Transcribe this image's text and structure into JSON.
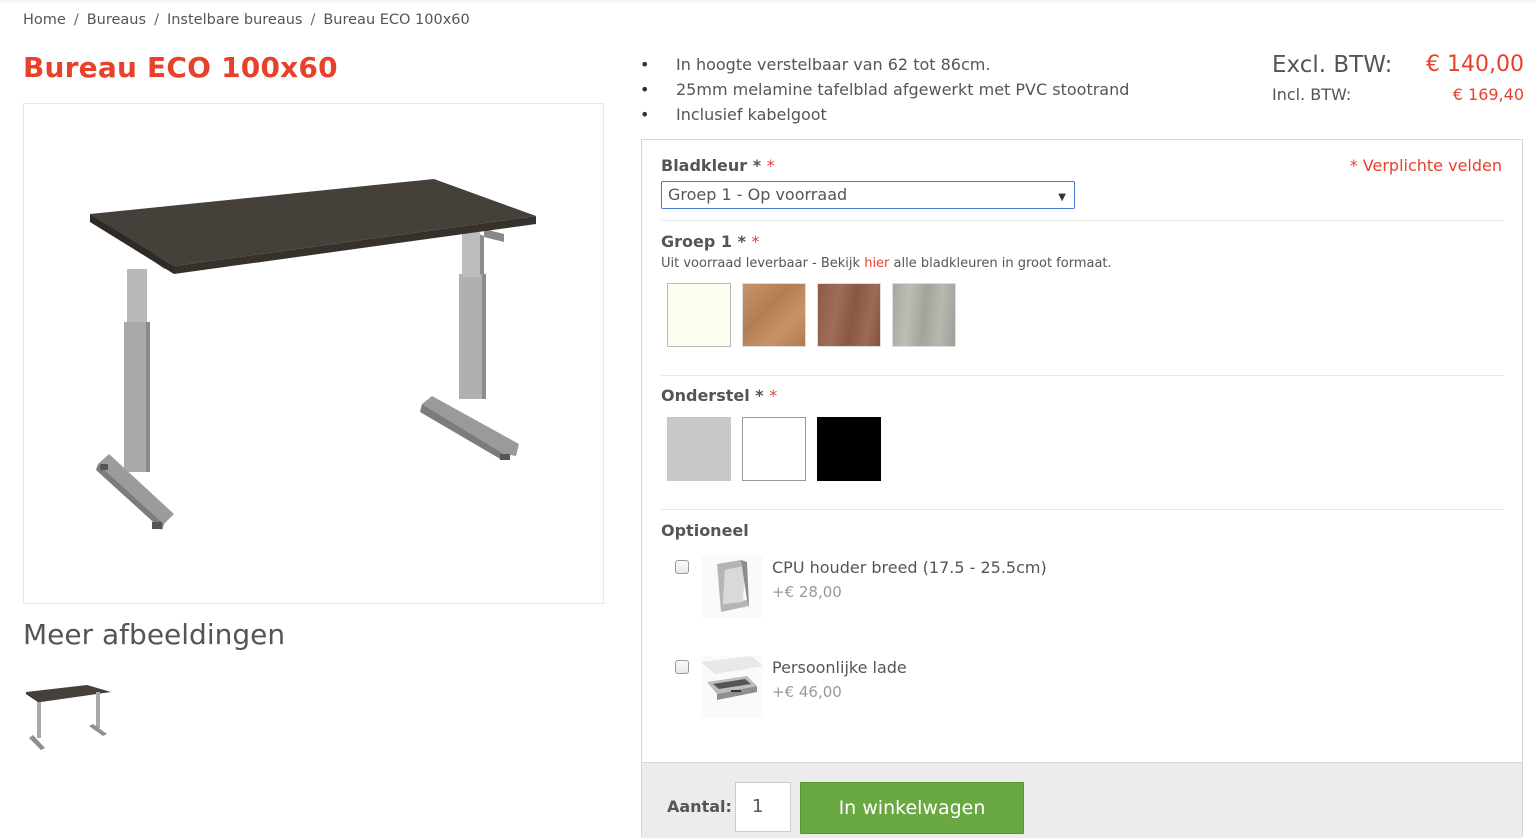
{
  "breadcrumb": {
    "items": [
      "Home",
      "Bureaus",
      "Instelbare bureaus",
      "Bureau ECO 100x60"
    ],
    "separator": "/"
  },
  "product": {
    "title": "Bureau ECO 100x60",
    "more_images_title": "Meer afbeeldingen",
    "features": [
      "In hoogte verstelbaar van 62 tot 86cm.",
      "25mm melamine tafelblad afgewerkt met PVC stootrand",
      "Inclusief kabelgoot"
    ]
  },
  "prices": {
    "excl_label": "Excl. BTW:",
    "excl_value": "€ 140,00",
    "incl_label": "Incl. BTW:",
    "incl_value": "€ 169,40"
  },
  "config": {
    "bladkleur_label": "Bladkleur *",
    "required_mark": "*",
    "required_note": "* Verplichte velden",
    "bladkleur_selected": "Groep 1 - Op voorraad",
    "groep_label": "Groep 1 *",
    "groep_desc_before": "Uit voorraad leverbaar - Bekijk ",
    "groep_desc_link": "hier",
    "groep_desc_after": " alle bladkleuren in groot formaat.",
    "groep_swatches": [
      "cream-white",
      "light-oak",
      "walnut",
      "grey-oak"
    ],
    "onderstel_label": "Onderstel *",
    "onderstel_swatches": [
      "aluminium-grey",
      "white",
      "black"
    ],
    "optioneel_label": "Optioneel",
    "options": [
      {
        "name": "CPU houder breed (17.5 - 25.5cm)",
        "price": "+€ 28,00",
        "checked": false
      },
      {
        "name": "Persoonlijke lade",
        "price": "+€ 46,00",
        "checked": false
      }
    ]
  },
  "cart": {
    "aantal_label": "Aantal:",
    "quantity": "1",
    "button_label": "In winkelwagen"
  },
  "colors": {
    "accent": "#e8412b",
    "button_green": "#6aa842",
    "select_border": "#4a7bd0"
  }
}
